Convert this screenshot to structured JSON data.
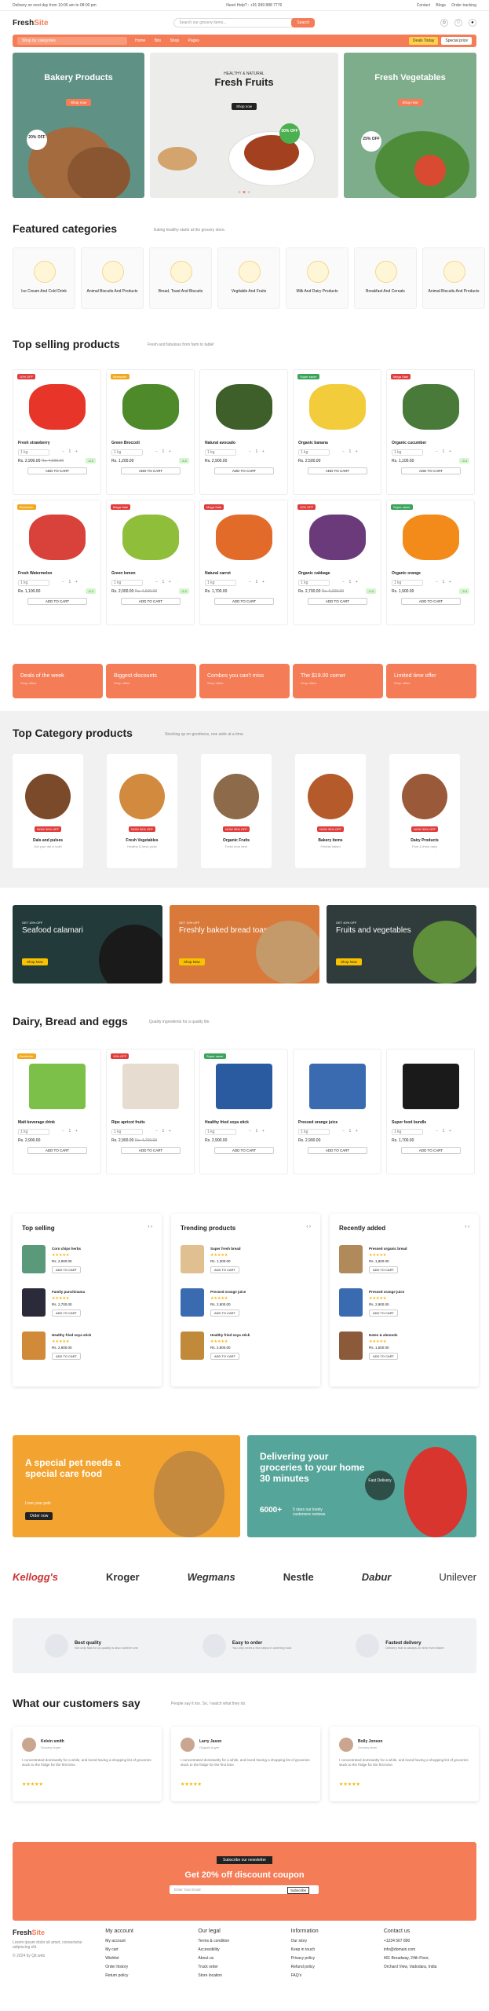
{
  "topbar": {
    "left": "Delivery on next day from 10:00 am to 08:00 pm",
    "help": "Need Help? : +91 999 888 7776",
    "links": [
      "Contact",
      "Blogs",
      "Order tracking"
    ]
  },
  "header": {
    "logo_a": "Fresh",
    "logo_b": "Site",
    "search_placeholder": "Search our grocery items...",
    "search_btn": "Search"
  },
  "nav": {
    "category": "Shop by categories",
    "links": [
      "Home",
      "Bits",
      "Shop",
      "Pages"
    ],
    "deal1": "Deals Today",
    "deal2": "Special price"
  },
  "hero": [
    {
      "title": "Bakery Products",
      "btn": "Shop now",
      "disc": "20% OFF"
    },
    {
      "tag": "HEALTHY & NATURAL",
      "title": "Fresh Fruits",
      "btn": "Shop now",
      "disc": "30% OFF"
    },
    {
      "title": "Fresh Vegetables",
      "btn": "Shop now",
      "disc": "25% OFF"
    }
  ],
  "featured": {
    "title": "Featured categories",
    "sub": "Eating healthy starts at the grocery store.",
    "items": [
      "Ice Cream And Cold Drink",
      "Animal Biscuits And Products",
      "Bread, Toast And Biscuits",
      "Vegitable And Fruits",
      "Milk And Dairy Products",
      "Breakfast And Cereals",
      "Animal Biscuits And Products"
    ]
  },
  "topselling": {
    "title": "Top selling products",
    "sub": "Fresh and fabulous from farm to table!",
    "products": [
      {
        "name": "Fresh strawberry",
        "badge": "10% OFF",
        "price": "Rs. 2,900.00",
        "old": "Rs. 4,000.00",
        "save": "-5.2"
      },
      {
        "name": "Green Broccoli",
        "badge": "Bestseller",
        "price": "Rs. 1,200.00",
        "old": "",
        "save": "-5.2"
      },
      {
        "name": "Natural avocado",
        "badge": "",
        "price": "Rs. 2,900.00",
        "old": "",
        "save": ""
      },
      {
        "name": "Organic banana",
        "badge": "Super saver",
        "price": "Rs. 2,500.00",
        "old": "",
        "save": ""
      },
      {
        "name": "Organic cucumber",
        "badge": "Mega Sale",
        "price": "Rs. 1,100.00",
        "old": "",
        "save": "-3.4"
      },
      {
        "name": "Fresh Watermelon",
        "badge": "Bestseller",
        "price": "Rs. 1,100.00",
        "old": "",
        "save": "-5.2"
      },
      {
        "name": "Green lemon",
        "badge": "Mega Sale",
        "price": "Rs. 2,000.00",
        "old": "Rs. 4,600.00",
        "save": "-5.2"
      },
      {
        "name": "Natural carrot",
        "badge": "Mega Sale",
        "price": "Rs. 1,700.00",
        "old": "",
        "save": ""
      },
      {
        "name": "Organic cabbage",
        "badge": "10% OFF",
        "price": "Rs. 2,700.00",
        "old": "Rs. 6,000.00",
        "save": "-3.4"
      },
      {
        "name": "Organic orange",
        "badge": "Super saver",
        "price": "Rs. 1,900.00",
        "old": "",
        "save": "-3.3"
      }
    ],
    "add": "ADD TO CART",
    "size": "1 kg"
  },
  "offers": [
    {
      "t": "Deals of the week",
      "s": "Shop offers"
    },
    {
      "t": "Biggest discounts",
      "s": "Shop offers"
    },
    {
      "t": "Combos you can't miss",
      "s": "Shop offers"
    },
    {
      "t": "The $19.00 corner",
      "s": "Shop offers"
    },
    {
      "t": "Limited time offer",
      "s": "Shop offers"
    }
  ],
  "topcategory": {
    "title": "Top Category products",
    "sub": "Stocking up on goodness, one aisle at a time.",
    "items": [
      {
        "name": "Dals and pulses",
        "sub": "Get your dal in bulk!"
      },
      {
        "name": "Fresh Vegetables",
        "sub": "Healthy & fresh picks"
      },
      {
        "name": "Organic Fruits",
        "sub": "Fresh from farm"
      },
      {
        "name": "Bakery items",
        "sub": "Freshly baked"
      },
      {
        "name": "Dairy Products",
        "sub": "Pure & fresh dairy"
      }
    ],
    "badge": "NOW 30% OFF"
  },
  "banners": [
    {
      "s": "GET 15% OFF",
      "t": "Seafood calamari",
      "b": "Shop Now"
    },
    {
      "s": "GET 10% OFF",
      "t": "Freshly baked bread toast",
      "b": "Shop Now"
    },
    {
      "s": "GET 40% OFF",
      "t": "Fruits and vegetables",
      "b": "Shop Now"
    }
  ],
  "dairy": {
    "title": "Dairy, Bread and eggs",
    "sub": "Quality ingredients for a quality life.",
    "products": [
      {
        "name": "Malt beverage drink",
        "badge": "Bestseller",
        "price": "Rs. 2,900.00",
        "old": ""
      },
      {
        "name": "Ripe apricot fruits",
        "badge": "10% OFF",
        "price": "Rs. 2,900.00",
        "old": "Rs. 4,700.00"
      },
      {
        "name": "Healthy fried soya stick",
        "badge": "Super saver",
        "price": "Rs. 2,900.00",
        "old": ""
      },
      {
        "name": "Pressed orange juice",
        "badge": "",
        "price": "Rs. 2,900.00",
        "old": ""
      },
      {
        "name": "Super food bundle",
        "badge": "",
        "price": "Rs. 1,700.00",
        "old": ""
      }
    ]
  },
  "lists": [
    {
      "title": "Top selling",
      "items": [
        {
          "n": "Corn chips herbs",
          "p": "Rs. 2,900.00"
        },
        {
          "n": "Family punchinama",
          "p": "Rs. 2,700.00"
        },
        {
          "n": "Healthy fried soya stick",
          "p": "Rs. 2,900.00"
        }
      ]
    },
    {
      "title": "Trending products",
      "items": [
        {
          "n": "Super fresh bread",
          "p": "Rs. 1,300.00"
        },
        {
          "n": "Pressed orange juice",
          "p": "Rs. 2,900.00"
        },
        {
          "n": "Healthy fried soya stick",
          "p": "Rs. 2,900.00"
        }
      ]
    },
    {
      "title": "Recently added",
      "items": [
        {
          "n": "Pressed organic bread",
          "p": "Rs. 1,800.00"
        },
        {
          "n": "Pressed orange juice",
          "p": "Rs. 2,900.00"
        },
        {
          "n": "Dates & almonds",
          "p": "Rs. 1,500.00"
        }
      ]
    }
  ],
  "promo": [
    {
      "t": "A special pet needs a special care food",
      "s": "Love your pets",
      "b": "Order now"
    },
    {
      "t": "Delivering your groceries to your home 30 minutes",
      "stat": "6000+",
      "stat_sub": "5 stars our lovely customers reviews",
      "badge": "Fast Delivery"
    }
  ],
  "brands": [
    "Kellogg's",
    "Kroger",
    "Wegmans",
    "Nestle",
    "Dabur",
    "Unilever"
  ],
  "features": [
    {
      "t": "Best quality",
      "s": "Not only fast for us quality is also number one"
    },
    {
      "t": "Easy to order",
      "s": "You only need a few steps in ordering food"
    },
    {
      "t": "Fastest delivery",
      "s": "Delivery that is always on time even faster"
    }
  ],
  "testimonials": {
    "title": "What our customers say",
    "sub": "People say it too. So, I watch what they do.",
    "items": [
      {
        "n": "Kelvin smith",
        "r": "Grocery buyer"
      },
      {
        "n": "Larry Jason",
        "r": "Organic buyer"
      },
      {
        "n": "Bolly Jonson",
        "r": "Grocery store"
      }
    ],
    "quote": "I concentrated dominantly for a while, and loved having a shopping list of groceries stuck to the fridge for the first time."
  },
  "newsletter": {
    "pill": "Subscribe our newsletter",
    "title": "Get 20% off discount coupon",
    "ph": "Enter Your Email",
    "btn": "Subscribe"
  },
  "footer": {
    "about": "Lorem ipsum dolor sit amet, consectetur adipiscing elit.",
    "copy": "© 2024 by Qit.web",
    "cols": [
      {
        "h": "My account",
        "l": [
          "My account",
          "My cart",
          "Wishlist",
          "Order history",
          "Return policy"
        ]
      },
      {
        "h": "Our legal",
        "l": [
          "Terms & condition",
          "Accessibility",
          "About us",
          "Track order",
          "Store location"
        ]
      },
      {
        "h": "Information",
        "l": [
          "Our story",
          "Keep in touch",
          "Privacy policy",
          "Refund policy",
          "FAQ's"
        ]
      },
      {
        "h": "Contact us",
        "l": [
          "+1234 567 890",
          "info@domain.com",
          "401 Broadway, 24th Floor,",
          "Orchard View, Vadodara, India"
        ]
      }
    ]
  }
}
